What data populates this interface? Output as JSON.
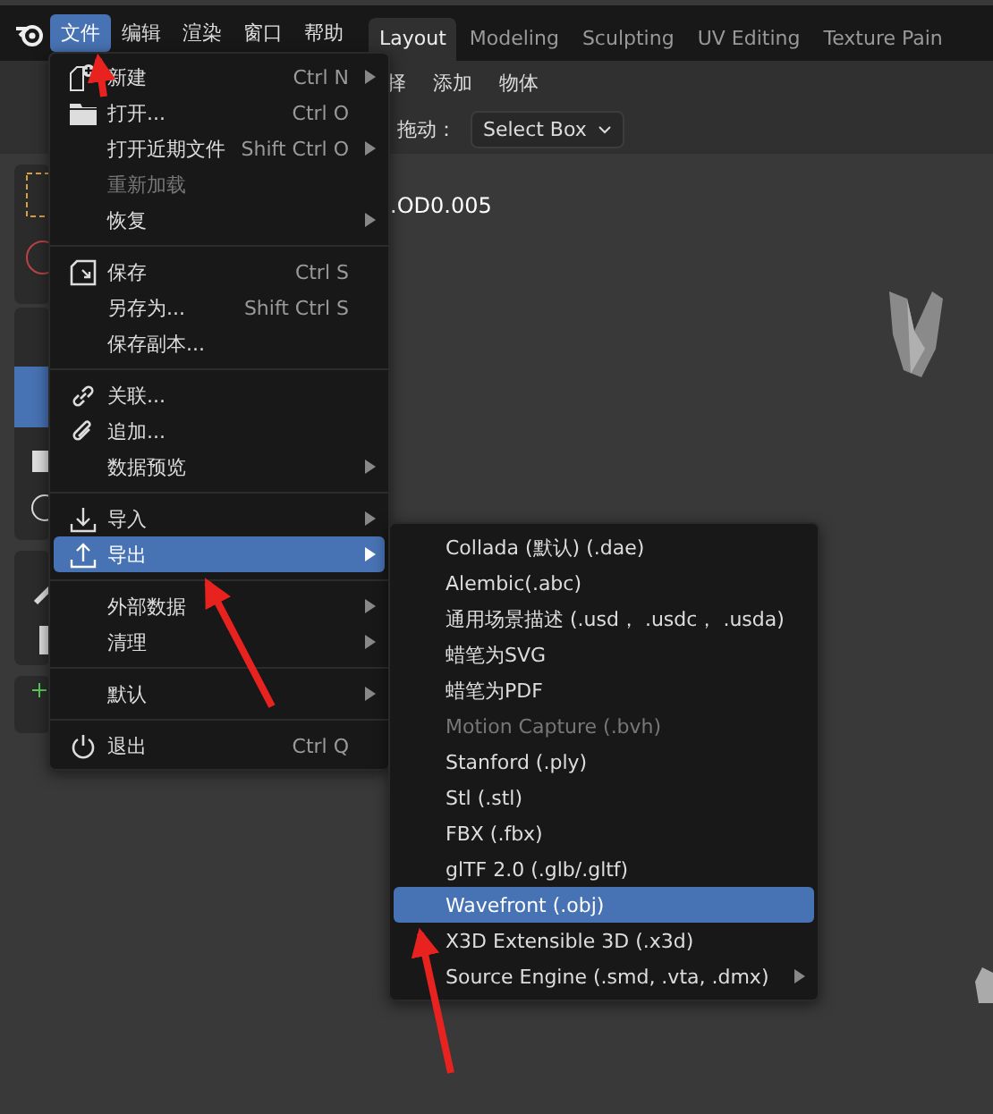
{
  "topbar": {
    "menus": [
      {
        "label": "文件",
        "selected": true
      },
      {
        "label": "编辑",
        "selected": false
      },
      {
        "label": "渲染",
        "selected": false
      },
      {
        "label": "窗口",
        "selected": false
      },
      {
        "label": "帮助",
        "selected": false
      }
    ],
    "workspace_tabs": [
      {
        "label": "Layout",
        "selected": true
      },
      {
        "label": "Modeling",
        "selected": false
      },
      {
        "label": "Sculpting",
        "selected": false
      },
      {
        "label": "UV Editing",
        "selected": false
      },
      {
        "label": "Texture Pain",
        "selected": false
      }
    ]
  },
  "header": {
    "menus": [
      "择",
      "添加",
      "物体"
    ],
    "drag_label": "拖动：",
    "drag_mode": "Select Box"
  },
  "viewport": {
    "object_label": ".OD0.005"
  },
  "file_menu": {
    "groups": [
      [
        {
          "label": "新建",
          "shortcut": "Ctrl N",
          "submenu": true,
          "disabled": false,
          "selected": false
        },
        {
          "label": "打开...",
          "shortcut": "Ctrl O",
          "submenu": false,
          "disabled": false,
          "selected": false
        },
        {
          "label": "打开近期文件",
          "shortcut": "Shift Ctrl O",
          "submenu": true,
          "disabled": false,
          "selected": false
        },
        {
          "label": "重新加载",
          "submenu": false,
          "disabled": true,
          "selected": false
        },
        {
          "label": "恢复",
          "submenu": true,
          "disabled": false,
          "selected": false
        }
      ],
      [
        {
          "label": "保存",
          "shortcut": "Ctrl S",
          "submenu": false,
          "disabled": false,
          "selected": false
        },
        {
          "label": "另存为...",
          "shortcut": "Shift Ctrl S",
          "submenu": false,
          "disabled": false,
          "selected": false
        },
        {
          "label": "保存副本...",
          "submenu": false,
          "disabled": false,
          "selected": false
        }
      ],
      [
        {
          "label": "关联...",
          "submenu": false,
          "disabled": false,
          "selected": false
        },
        {
          "label": "追加...",
          "submenu": false,
          "disabled": false,
          "selected": false
        },
        {
          "label": "数据预览",
          "submenu": true,
          "disabled": false,
          "selected": false
        }
      ],
      [
        {
          "label": "导入",
          "submenu": true,
          "disabled": false,
          "selected": false
        },
        {
          "label": "导出",
          "submenu": true,
          "disabled": false,
          "selected": true
        }
      ],
      [
        {
          "label": "外部数据",
          "submenu": true,
          "disabled": false,
          "selected": false
        },
        {
          "label": "清理",
          "submenu": true,
          "disabled": false,
          "selected": false
        }
      ],
      [
        {
          "label": "默认",
          "submenu": true,
          "disabled": false,
          "selected": false
        }
      ],
      [
        {
          "label": "退出",
          "shortcut": "Ctrl Q",
          "submenu": false,
          "disabled": false,
          "selected": false
        }
      ]
    ]
  },
  "export_menu": {
    "items": [
      {
        "label": "Collada (默认) (.dae)",
        "submenu": false,
        "disabled": false,
        "selected": false
      },
      {
        "label": "Alembic(.abc)",
        "submenu": false,
        "disabled": false,
        "selected": false
      },
      {
        "label": "通用场景描述 (.usd， .usdc， .usda)",
        "submenu": false,
        "disabled": false,
        "selected": false
      },
      {
        "label": "蜡笔为SVG",
        "submenu": false,
        "disabled": false,
        "selected": false
      },
      {
        "label": "蜡笔为PDF",
        "submenu": false,
        "disabled": false,
        "selected": false
      },
      {
        "label": "Motion Capture (.bvh)",
        "submenu": false,
        "disabled": true,
        "selected": false
      },
      {
        "label": "Stanford (.ply)",
        "submenu": false,
        "disabled": false,
        "selected": false
      },
      {
        "label": "Stl (.stl)",
        "submenu": false,
        "disabled": false,
        "selected": false
      },
      {
        "label": "FBX (.fbx)",
        "submenu": false,
        "disabled": false,
        "selected": false
      },
      {
        "label": "glTF 2.0 (.glb/.gltf)",
        "submenu": false,
        "disabled": false,
        "selected": false
      },
      {
        "label": "Wavefront (.obj)",
        "submenu": false,
        "disabled": false,
        "selected": true
      },
      {
        "label": "X3D Extensible 3D (.x3d)",
        "submenu": false,
        "disabled": false,
        "selected": false
      },
      {
        "label": "Source Engine (.smd, .vta, .dmx)",
        "submenu": true,
        "disabled": false,
        "selected": false
      }
    ]
  }
}
